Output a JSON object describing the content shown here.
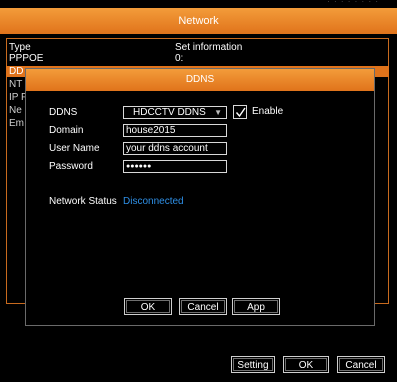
{
  "top_strip": {
    "faint_text": "· · · · · · · ·"
  },
  "network": {
    "title": "Network",
    "columns": {
      "type": "Type",
      "info": "Set information"
    },
    "rows": [
      {
        "type": "PPPOE",
        "info": "0:"
      },
      {
        "type": "DD"
      },
      {
        "type": "NT"
      },
      {
        "type": "IP F"
      },
      {
        "type": "Ne"
      },
      {
        "type": "Em"
      }
    ],
    "buttons": {
      "setting": "Setting",
      "ok": "OK",
      "cancel": "Cancel"
    }
  },
  "ddns": {
    "title": "DDNS",
    "labels": {
      "ddns": "DDNS",
      "domain": "Domain",
      "username": "User Name",
      "password": "Password",
      "network_status": "Network Status"
    },
    "provider": "HDCCTV DDNS",
    "domain_value": "house2015",
    "username_value": "your ddns account",
    "password_value": "●●●●●●",
    "enable_label": "Enable",
    "enabled": true,
    "status_value": "Disconnected",
    "buttons": {
      "ok": "OK",
      "cancel": "Cancel",
      "app": "App"
    }
  },
  "colors": {
    "accent": "#e0731b",
    "status": "#2e8fe6"
  }
}
